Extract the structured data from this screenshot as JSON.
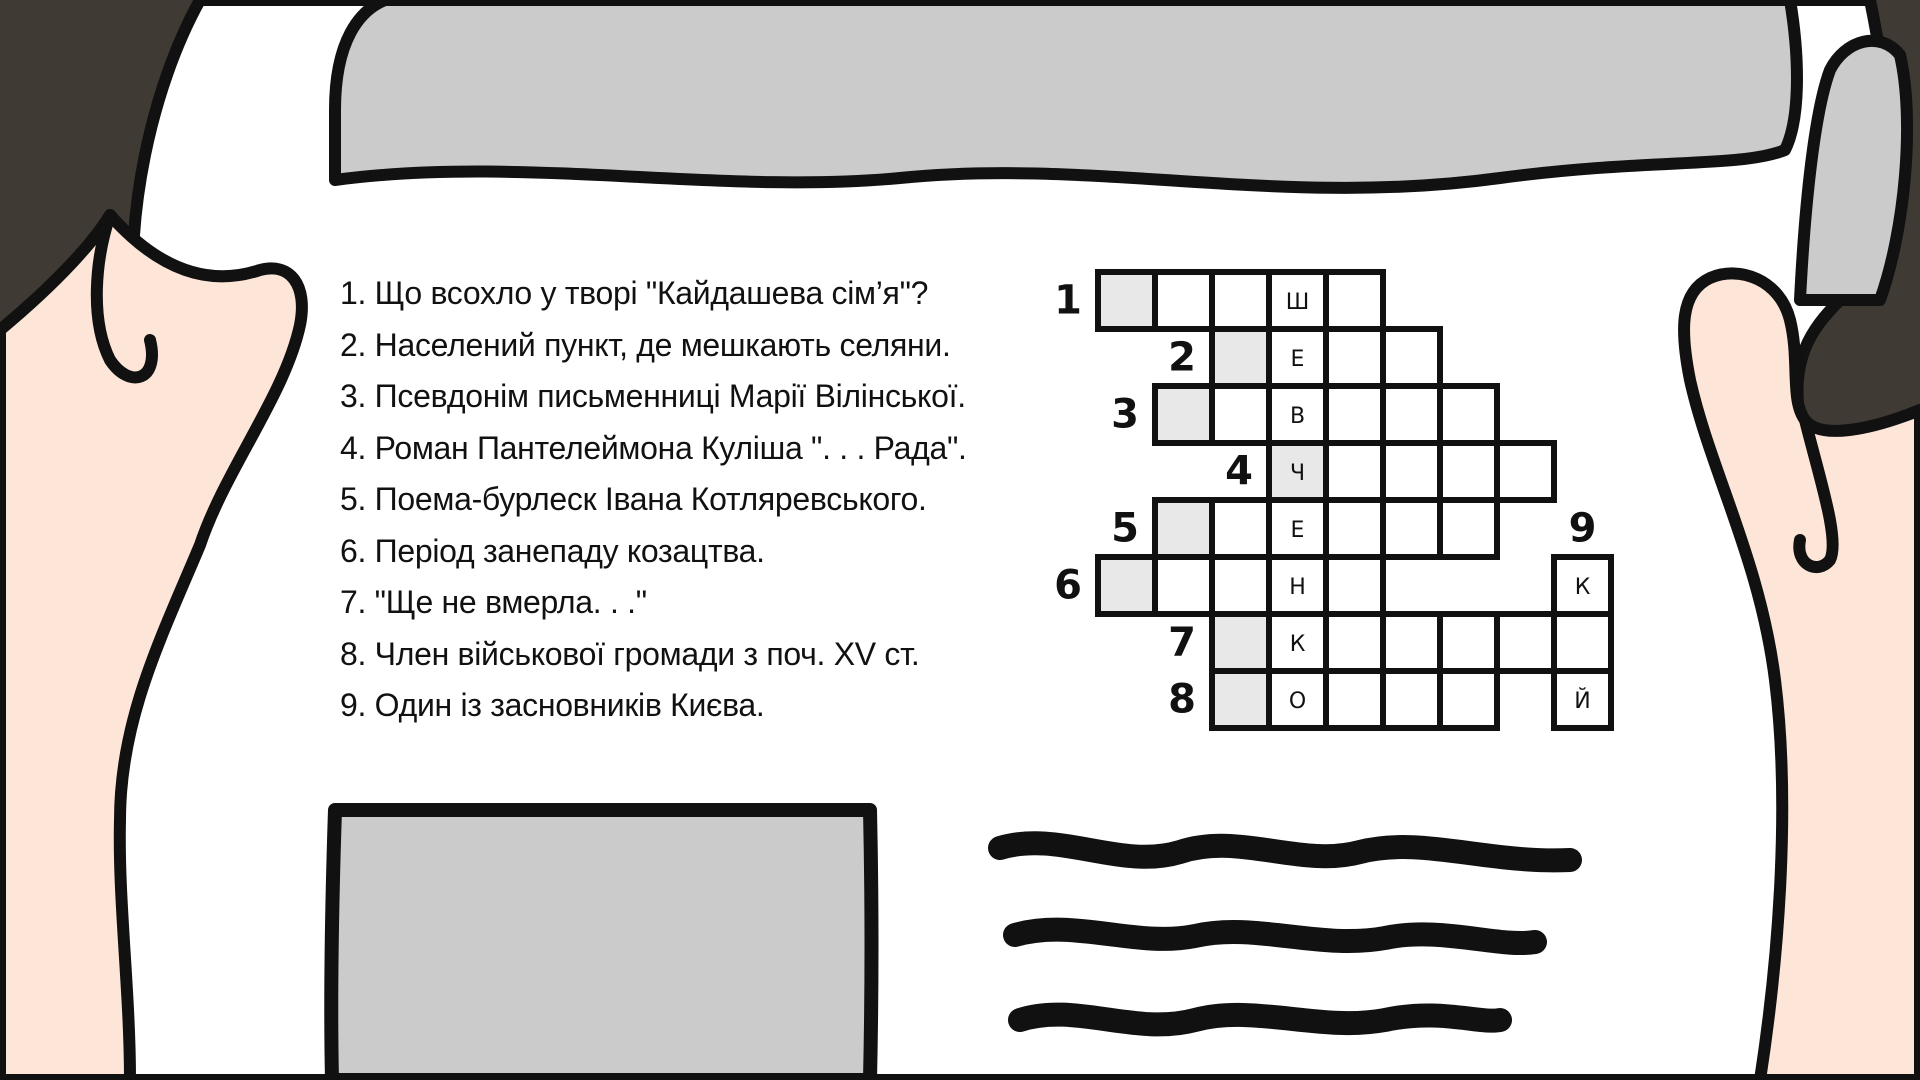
{
  "clues": [
    "1. Що всохло у творі \"Кайдашева сім’я\"?",
    "2. Населений пункт, де мешкають селяни.",
    "3. Псевдонім письменниці Марії Вілінської.",
    "4. Роман Пантелеймона Куліша \". . . Рада\".",
    "5. Поема-бурлеск Івана Котляревського.",
    "6. Період занепаду козацтва.",
    "7. \"Ще не вмерла. . .\"",
    "8. Член військової громади з поч. XV ст.",
    "9. Один із засновників Києва."
  ],
  "crossword": {
    "row_numbers": [
      "1",
      "2",
      "3",
      "4",
      "5",
      "6",
      "7",
      "8"
    ],
    "column_number": "9",
    "key_word_letters": [
      "Ш",
      "Е",
      "В",
      "Ч",
      "Е",
      "Н",
      "К",
      "О"
    ],
    "column_letters": {
      "row6": "К",
      "row8": "Й"
    }
  },
  "colors": {
    "background": "#3f3a33",
    "paper": "#ffffff",
    "gray_block": "#cbcbcb",
    "shaded_cell": "#e8e8e8",
    "skin": "#fde5d8",
    "outline": "#111111"
  }
}
